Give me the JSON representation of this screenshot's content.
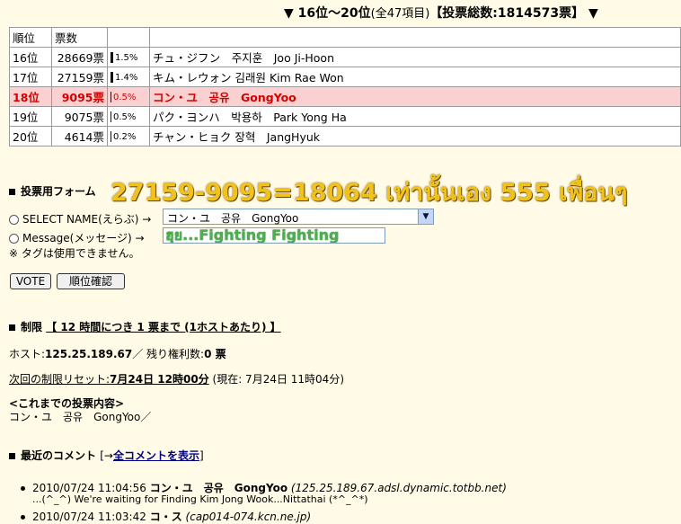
{
  "header": {
    "left_mark": "▼",
    "range": "16位～20位",
    "items": "(全47項目)",
    "total": "【投票総数:1814573票】",
    "right_mark": "▼"
  },
  "table": {
    "col_rank": "順位",
    "col_votes": "票数",
    "rows": [
      {
        "rank": "16位",
        "votes": "28669票",
        "pct": "1.5%",
        "name": "チュ・ジフン　주지훈　Joo Ji-Hoon"
      },
      {
        "rank": "17位",
        "votes": "27159票",
        "pct": "1.4%",
        "name": "キム・レウォン 김래원 Kim Rae Won"
      },
      {
        "rank": "18位",
        "votes": "9095票",
        "pct": "0.5%",
        "name": "コン・ユ　공유　GongYoo"
      },
      {
        "rank": "19位",
        "votes": "9075票",
        "pct": "0.5%",
        "name": "パク・ヨンハ　박용하　Park Yong Ha"
      },
      {
        "rank": "20位",
        "votes": "4614票",
        "pct": "0.2%",
        "name": "チャン・ヒョク 장혁　JangHyuk"
      }
    ]
  },
  "form": {
    "title": "投票用フォーム",
    "overlay": "27159-9095=18064 เท่านั้นเอง 555 เพื่อนๆ",
    "select_label": "SELECT NAME(えらぶ) →",
    "select_value": "コン・ユ　공유　GongYoo",
    "message_label": "Message(メッセージ) →",
    "message_value": "ฮุย...Fighting Fighting",
    "tag_note": "※ タグは使用できません。",
    "vote_button": "VOTE",
    "rank_button": "順位確認"
  },
  "limit": {
    "title": "制限",
    "rule": "【 12 時間につき 1 票まで (1ホストあたり) 】",
    "host_label": "ホスト:",
    "host_value": "125.25.189.67",
    "remain_label": "／ 残り権利数:",
    "remain_value": "0 票",
    "reset_label": "次回の制限リセット:",
    "reset_value": "7月24日 12時00分",
    "now_text": "(現在: 7月24日 11時04分)",
    "history_title": "<これまでの投票内容>",
    "history_value": "コン・ユ　공유　GongYoo／"
  },
  "comments": {
    "title": "最近のコメント",
    "link_prefix": "[→",
    "link_text": "全コメントを表示",
    "link_suffix": "]",
    "items": [
      {
        "time": "2010/07/24 11:04:56",
        "name": "コン・ユ　공유　GongYoo",
        "host": "(125.25.189.67.adsl.dynamic.totbb.net)",
        "text": "...(^_^) We're waiting for Finding Kim Jong Wook...Nittathai (*^_^*)"
      },
      {
        "time": "2010/07/24 11:03:42",
        "name": "コ・ス",
        "host": "(cap014-074.kcn.ne.jp)",
        "text": ""
      }
    ]
  }
}
